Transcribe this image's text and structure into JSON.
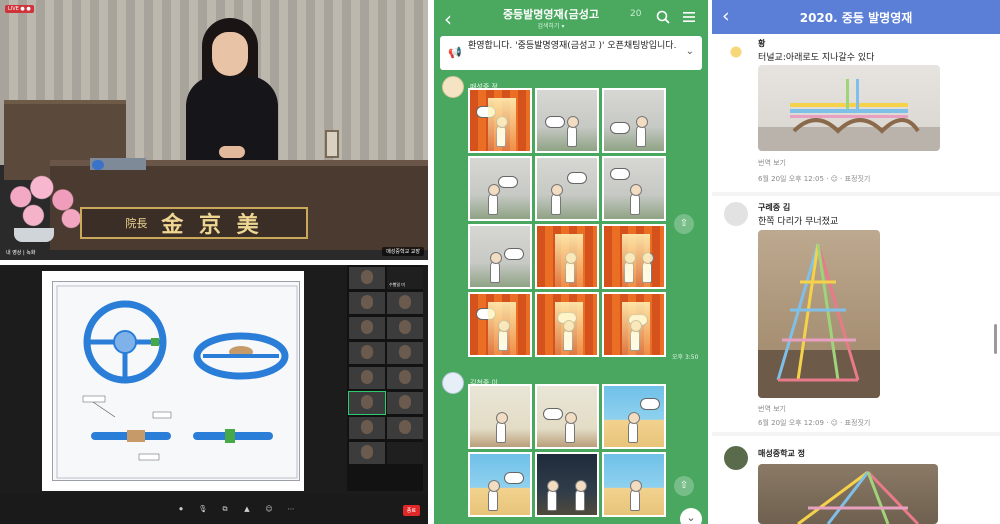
{
  "video_call": {
    "top_badge": "LIVE ● ●",
    "nameplate_small": "院長",
    "nameplate_name": "金 京 美",
    "caption": "내 영상 | 녹화",
    "name_chip": "매성중학교 교장"
  },
  "screen_share": {
    "participants": [
      "",
      "수행일 미",
      "",
      "",
      "",
      "",
      "",
      "",
      "",
      "",
      "",
      "",
      "",
      "",
      "",
      ""
    ],
    "toolbar": [
      "⏺",
      "🎙",
      "⧉",
      "▲",
      "☺",
      "⋯"
    ],
    "end_label": "종료"
  },
  "chat": {
    "title": "중등발명영재(금성고",
    "subtitle": "검색하기 ▾",
    "member_count": "20",
    "notice": "환영합니다. '중등발명영재(금성고 )' 오픈채팅방입니다.",
    "messages": [
      {
        "sender": "매성중 정",
        "time": "오후 3:50"
      },
      {
        "sender": "김천중 이",
        "time": ""
      }
    ],
    "colors": {
      "background": "#49a75f",
      "header": "#4aa95f"
    }
  },
  "feed": {
    "title": "2020. 중등 발명영재",
    "posts": [
      {
        "author": "황",
        "text": "터널교:아래로도 지나갈수 있다",
        "translate": "번역 보기",
        "meta": "6월 20일 오후 12:05 · ☺ · 표정짓기"
      },
      {
        "author": "구례중 김",
        "text": "한쪽 다리가 무너졌교",
        "translate": "번역 보기",
        "meta": "6월 20일 오후 12:09 · ☺ · 표정짓기"
      },
      {
        "author": "매성중학교 정",
        "text": "",
        "translate": "",
        "meta": ""
      }
    ],
    "colors": {
      "header": "#5b7fd6"
    }
  }
}
